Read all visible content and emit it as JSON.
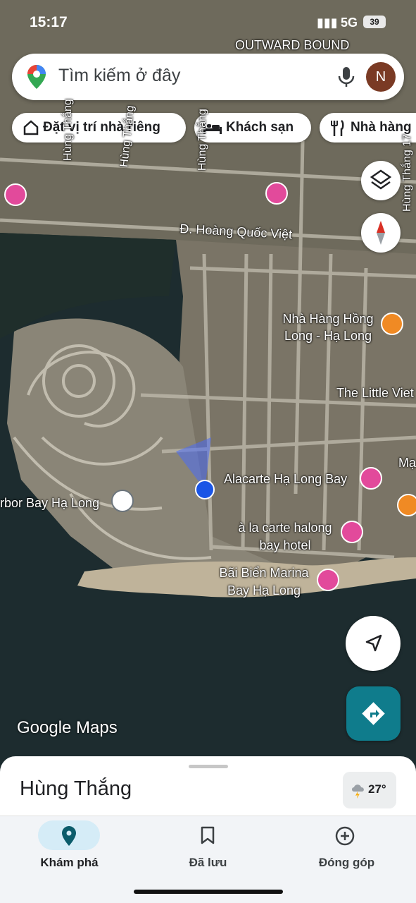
{
  "status_bar": {
    "time": "15:17",
    "network": "5G",
    "battery": "39"
  },
  "search": {
    "placeholder": "Tìm kiếm ở đây",
    "avatar_initial": "N"
  },
  "chips": [
    {
      "label": "Đặt vị trí nhà riêng",
      "icon": "home-icon"
    },
    {
      "label": "Khách sạn",
      "icon": "bed-icon"
    },
    {
      "label": "Nhà hàng",
      "icon": "restaurant-icon"
    }
  ],
  "map": {
    "top_label": "OUTWARD BOUND",
    "street_labels": [
      "Hùng Thắng",
      "Hùng Thắng",
      "Hùng Thắng",
      "Hùng Thắng 17",
      "Đ. Hoàng Quốc Việt"
    ],
    "places": [
      "Nhà Hàng Hồng Long - Hạ Long",
      "The Little Viet",
      "Alacarte Hạ Long Bay",
      "à la carte halong bay hotel",
      "Bãi Biển Marina Bay Hạ Long",
      "rbor Bay Hạ Long"
    ],
    "edge_label": "Mạ",
    "attribution": "Google Maps",
    "colors": {
      "hotel_pin": "#e24a9b",
      "restaurant_pin": "#f08a24",
      "location_dot": "#1a55e6",
      "direction_fab": "#0f7c8c"
    }
  },
  "sheet": {
    "place_title": "Hùng Thắng",
    "weather_temp": "27°"
  },
  "bottom_nav": [
    {
      "label": "Khám phá",
      "icon": "explore-pin-icon",
      "active": true
    },
    {
      "label": "Đã lưu",
      "icon": "bookmark-icon",
      "active": false
    },
    {
      "label": "Đóng góp",
      "icon": "add-circle-icon",
      "active": false
    }
  ]
}
